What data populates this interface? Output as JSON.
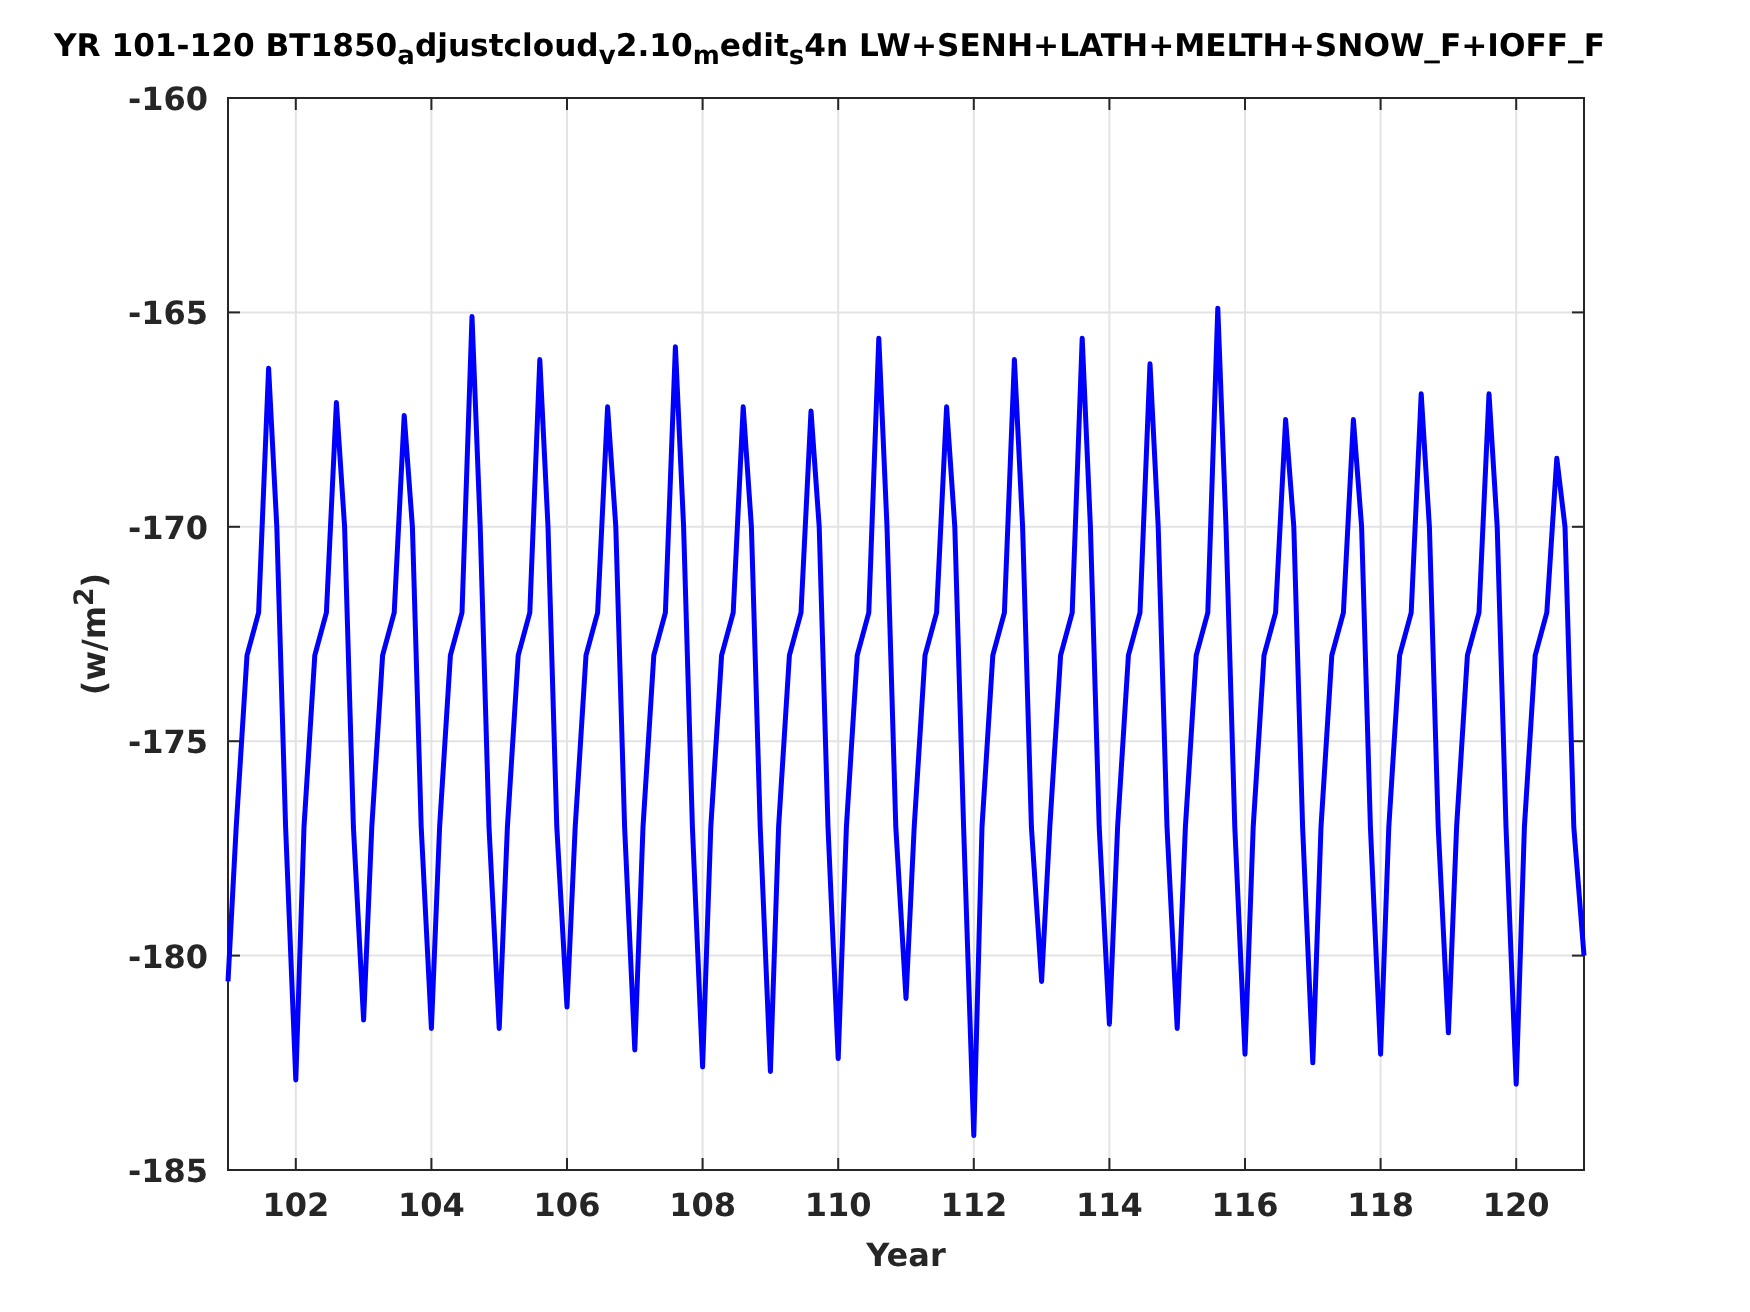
{
  "chart_data": {
    "type": "line",
    "title": "YR 101-120 BT1850$_{a}$djustcloud$_{v}$2.10$_{m}$edit$_{s}$4n LW+SENH+LATH+MELTH+SNOW_F+IOFF_F",
    "xlabel": "Year",
    "ylabel": "(w/m$^{2}$)",
    "grid": true,
    "xlim": [
      101,
      121
    ],
    "ylim": [
      -185,
      -160
    ],
    "xticks": [
      102,
      104,
      106,
      108,
      110,
      112,
      114,
      116,
      118,
      120
    ],
    "yticks": [
      -185,
      -180,
      -175,
      -170,
      -165,
      -160
    ],
    "x": [
      101,
      101.12,
      101.28,
      101.45,
      101.6,
      101.72,
      101.85,
      102,
      102.12,
      102.28,
      102.45,
      102.6,
      102.72,
      102.85,
      103,
      103.12,
      103.28,
      103.45,
      103.6,
      103.72,
      103.85,
      104,
      104.12,
      104.28,
      104.45,
      104.6,
      104.72,
      104.85,
      105,
      105.12,
      105.28,
      105.45,
      105.6,
      105.72,
      105.85,
      106,
      106.12,
      106.28,
      106.45,
      106.6,
      106.72,
      106.85,
      107,
      107.12,
      107.28,
      107.45,
      107.6,
      107.72,
      107.85,
      108,
      108.12,
      108.28,
      108.45,
      108.6,
      108.72,
      108.85,
      109,
      109.12,
      109.28,
      109.45,
      109.6,
      109.72,
      109.85,
      110,
      110.12,
      110.28,
      110.45,
      110.6,
      110.72,
      110.85,
      111,
      111.12,
      111.28,
      111.45,
      111.6,
      111.72,
      111.85,
      112,
      112.12,
      112.28,
      112.45,
      112.6,
      112.72,
      112.85,
      113,
      113.12,
      113.28,
      113.45,
      113.6,
      113.72,
      113.85,
      114,
      114.12,
      114.28,
      114.45,
      114.6,
      114.72,
      114.85,
      115,
      115.12,
      115.28,
      115.45,
      115.6,
      115.72,
      115.85,
      116,
      116.12,
      116.28,
      116.45,
      116.6,
      116.72,
      116.85,
      117,
      117.12,
      117.28,
      117.45,
      117.6,
      117.72,
      117.85,
      118,
      118.12,
      118.28,
      118.45,
      118.6,
      118.72,
      118.85,
      119,
      119.12,
      119.28,
      119.45,
      119.6,
      119.72,
      119.85,
      120,
      120.12,
      120.28,
      120.45,
      120.6,
      120.72,
      120.85,
      121
    ],
    "series": [
      {
        "color": "#0000ff",
        "values": [
          -180.6,
          -177,
          -173,
          -172,
          -166.3,
          -170,
          -177,
          -182.9,
          -177,
          -173,
          -172,
          -167.1,
          -170,
          -177,
          -181.5,
          -177,
          -173,
          -172,
          -167.4,
          -170,
          -177,
          -181.7,
          -177,
          -173,
          -172,
          -165.1,
          -170,
          -177,
          -181.7,
          -177,
          -173,
          -172,
          -166.1,
          -170,
          -177,
          -181.2,
          -177,
          -173,
          -172,
          -167.2,
          -170,
          -177,
          -182.2,
          -177,
          -173,
          -172,
          -165.8,
          -170,
          -177,
          -182.6,
          -177,
          -173,
          -172,
          -167.2,
          -170,
          -177,
          -182.7,
          -177,
          -173,
          -172,
          -167.3,
          -170,
          -177,
          -182.4,
          -177,
          -173,
          -172,
          -165.6,
          -170,
          -177,
          -181,
          -177,
          -173,
          -172,
          -167.2,
          -170,
          -177,
          -184.2,
          -177,
          -173,
          -172,
          -166.1,
          -170,
          -177,
          -180.6,
          -177,
          -173,
          -172,
          -165.6,
          -170,
          -177,
          -181.6,
          -177,
          -173,
          -172,
          -166.2,
          -170,
          -177,
          -181.7,
          -177,
          -173,
          -172,
          -164.9,
          -170,
          -177,
          -182.3,
          -177,
          -173,
          -172,
          -167.5,
          -170,
          -177,
          -182.5,
          -177,
          -173,
          -172,
          -167.5,
          -170,
          -177,
          -182.3,
          -177,
          -173,
          -172,
          -166.9,
          -170,
          -177,
          -181.8,
          -177,
          -173,
          -172,
          -166.9,
          -170,
          -177,
          -183,
          -177,
          -173,
          -172,
          -168.4,
          -170,
          -177,
          -180
        ]
      }
    ]
  }
}
